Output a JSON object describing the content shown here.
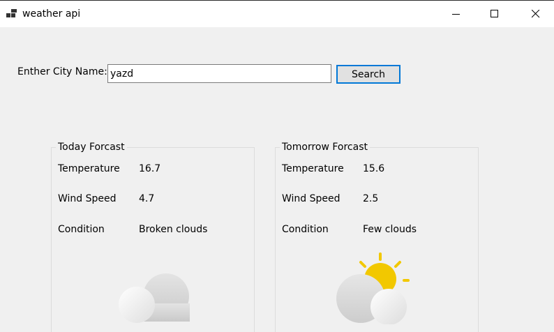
{
  "window": {
    "title": "weather api"
  },
  "search": {
    "label": "Enther City Name:",
    "value": "yazd",
    "button_label": "Search"
  },
  "today": {
    "title": "Today Forcast",
    "temperature_label": "Temperature",
    "temperature_value": "16.7",
    "wind_label": "Wind Speed",
    "wind_value": "4.7",
    "condition_label": "Condition",
    "condition_value": "Broken clouds",
    "icon": "broken-clouds-icon"
  },
  "tomorrow": {
    "title": "Tomorrow Forcast",
    "temperature_label": "Temperature",
    "temperature_value": "15.6",
    "wind_label": "Wind Speed",
    "wind_value": "2.5",
    "condition_label": "Condition",
    "condition_value": "Few clouds",
    "icon": "few-clouds-icon"
  },
  "colors": {
    "sun": "#f2c800",
    "focus_border": "#0078d7",
    "background": "#f0f0f0"
  }
}
